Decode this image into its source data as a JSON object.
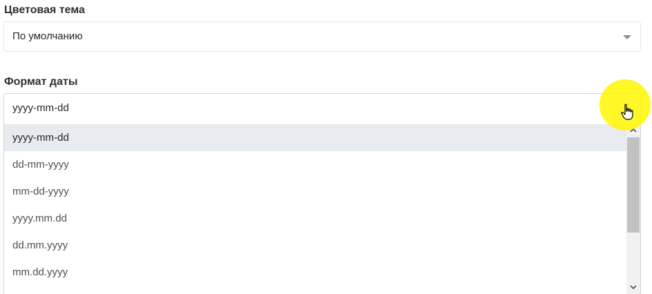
{
  "color_theme": {
    "label": "Цветовая тема",
    "value": "По умолчанию"
  },
  "date_format": {
    "label": "Формат даты",
    "value": "yyyy-mm-dd",
    "options": [
      "yyyy-mm-dd",
      "dd-mm-yyyy",
      "mm-dd-yyyy",
      "yyyy.mm.dd",
      "dd.mm.yyyy",
      "mm.dd.yyyy"
    ],
    "selected_index": 0
  },
  "colors": {
    "cursor_highlight": "#fff700",
    "selected_option_bg": "#e7eaef"
  },
  "icons": {
    "caret": "chevron-down-icon",
    "scroll_up": "chevron-up-icon",
    "scroll_down": "chevron-down-icon",
    "cursor": "hand-pointer-icon"
  }
}
